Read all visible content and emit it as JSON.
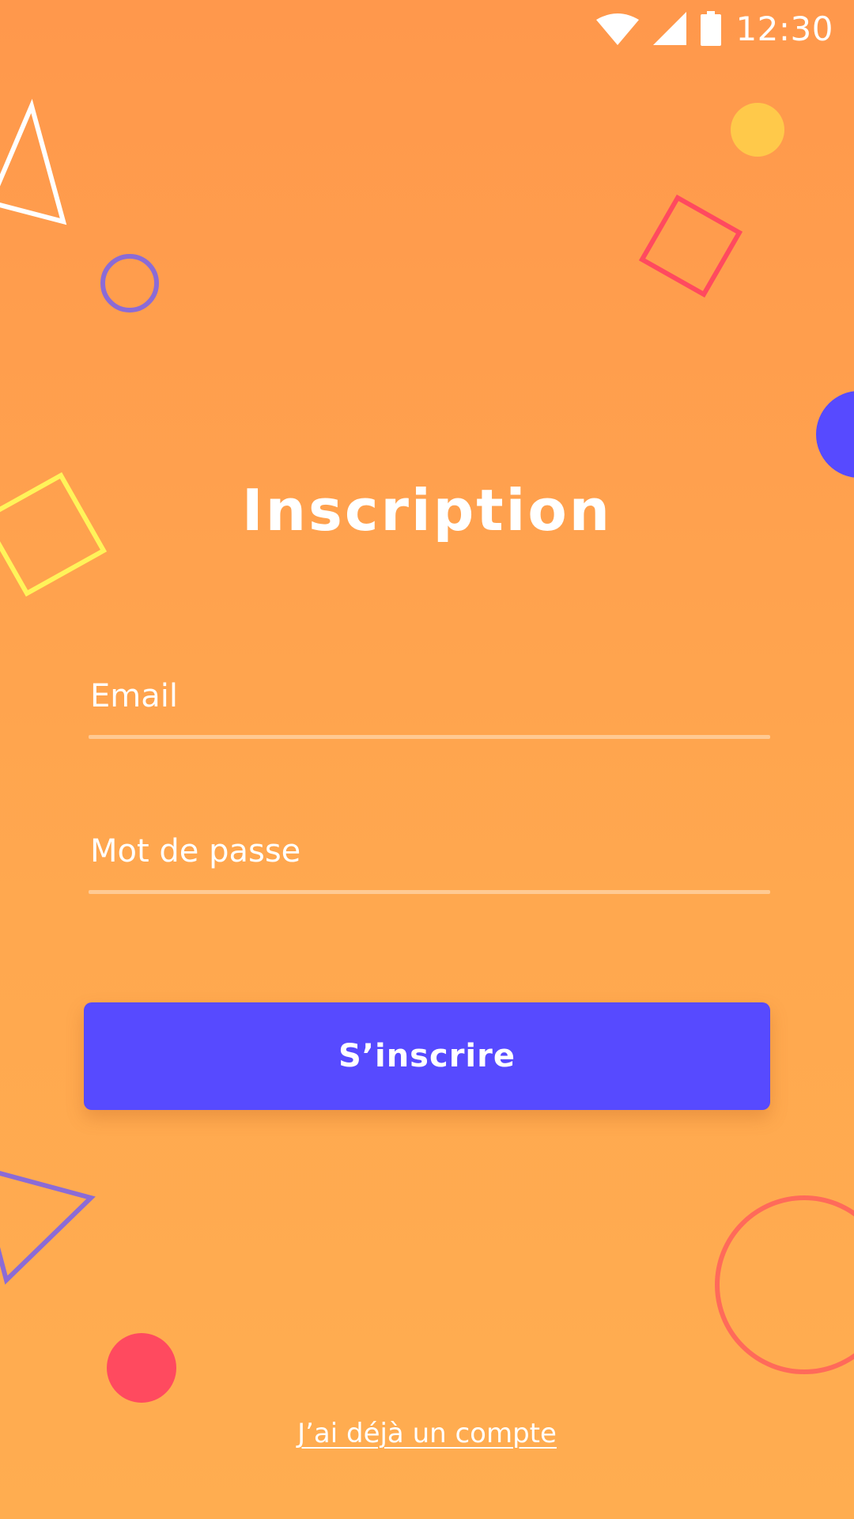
{
  "status_bar": {
    "time": "12:30",
    "icons": [
      "wifi-icon",
      "signal-icon",
      "battery-icon"
    ]
  },
  "title": "Inscription",
  "form": {
    "email_placeholder": "Email",
    "email_value": "",
    "password_placeholder": "Mot de passe",
    "password_value": ""
  },
  "signup_button_label": "S’inscrire",
  "login_link_label": "J’ai déjà un compte",
  "colors": {
    "background_top": "#FF984C",
    "background_bottom": "#FFAD50",
    "button": "#574AFF",
    "text": "#FFFFFF",
    "deco_purple": "#8B6BD6",
    "deco_red": "#FF4A5F",
    "deco_yellow": "#FFF35A",
    "deco_gold": "#FFC94A",
    "deco_blue": "#574AFF"
  }
}
